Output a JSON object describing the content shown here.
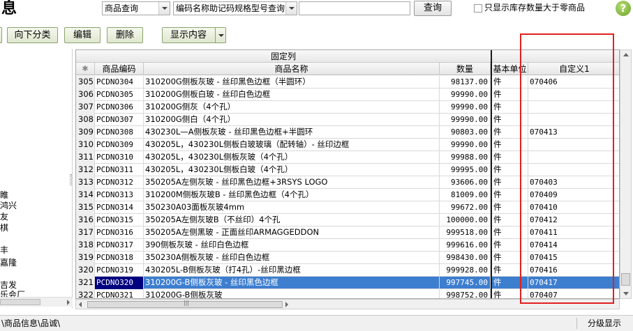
{
  "window": {
    "title": "息"
  },
  "search": {
    "mode_select": "商品查询",
    "field_select": "编码名称助记码规格型号查询",
    "input_value": "",
    "query_label": "查询",
    "stock_filter_label": "只显示库存数量大于零商品",
    "stock_filter_checked": false
  },
  "toolbar": {
    "down_category_label": "向下分类",
    "edit_label": "编辑",
    "delete_label": "删除",
    "display_label": "显示内容"
  },
  "tree": {
    "items": [
      "睢",
      "鸿兴",
      "友",
      "棋",
      "丰",
      "嘉隆",
      "吉发",
      "乐会厂"
    ]
  },
  "grid": {
    "fixed_columns_label": "固定列",
    "columns": {
      "row_marker": "✱",
      "code": "商品编码",
      "name": "商品名称",
      "quantity": "数量",
      "unit": "基本单位",
      "custom1": "自定义1"
    },
    "rows": [
      {
        "num": "305",
        "code": "PCDNO304",
        "name": "310200G侧板灰玻 - 丝印黑色边框（半圆环）",
        "qty": "98137.00",
        "unit": "件",
        "custom1": "070406",
        "selected": false
      },
      {
        "num": "306",
        "code": "PCDNO305",
        "name": "310200G侧板白玻 - 丝印白色边框",
        "qty": "99990.00",
        "unit": "件",
        "custom1": "",
        "selected": false
      },
      {
        "num": "307",
        "code": "PCDNO306",
        "name": "310200G侧灰（4个孔）",
        "qty": "99990.00",
        "unit": "件",
        "custom1": "",
        "selected": false
      },
      {
        "num": "308",
        "code": "PCDNO307",
        "name": "310200G侧白（4个孔）",
        "qty": "99990.00",
        "unit": "件",
        "custom1": "",
        "selected": false
      },
      {
        "num": "309",
        "code": "PCDNO308",
        "name": "430230L—A侧板灰玻 - 丝印黑色边框+半圆环",
        "qty": "90803.00",
        "unit": "件",
        "custom1": "070413",
        "selected": false
      },
      {
        "num": "310",
        "code": "PCDNO309",
        "name": "430205L，430230L侧板白玻玻璃（配转轴）- 丝印边框",
        "qty": "99990.00",
        "unit": "件",
        "custom1": "",
        "selected": false
      },
      {
        "num": "311",
        "code": "PCDNO310",
        "name": "430205L，430230L侧板灰玻（4个孔）",
        "qty": "99988.00",
        "unit": "件",
        "custom1": "",
        "selected": false
      },
      {
        "num": "312",
        "code": "PCDNO311",
        "name": "430205L，430230L侧板白玻（4个孔）",
        "qty": "99995.00",
        "unit": "件",
        "custom1": "",
        "selected": false
      },
      {
        "num": "313",
        "code": "PCDNO312",
        "name": "350205A左侧灰玻 - 丝印黑色边框+3RSYS LOGO",
        "qty": "93606.00",
        "unit": "件",
        "custom1": "070403",
        "selected": false
      },
      {
        "num": "314",
        "code": "PCDNO313",
        "name": "310200M侧板灰玻B - 丝印黑色边框（4个孔）",
        "qty": "81009.00",
        "unit": "件",
        "custom1": "070409",
        "selected": false
      },
      {
        "num": "315",
        "code": "PCDNO314",
        "name": "350230A03面板灰玻4mm",
        "qty": "99672.00",
        "unit": "件",
        "custom1": "070410",
        "selected": false
      },
      {
        "num": "316",
        "code": "PCDNO315",
        "name": "350205A左侧灰玻B（不丝印）4个孔",
        "qty": "100000.00",
        "unit": "件",
        "custom1": "070412",
        "selected": false
      },
      {
        "num": "317",
        "code": "PCDNO316",
        "name": "350205A左侧黑玻 - 正面丝印ARMAGGEDDON",
        "qty": "999518.00",
        "unit": "件",
        "custom1": "070411",
        "selected": false
      },
      {
        "num": "318",
        "code": "PCDNO317",
        "name": "390侧板灰玻 - 丝印白色边框",
        "qty": "999616.00",
        "unit": "件",
        "custom1": "070414",
        "selected": false
      },
      {
        "num": "319",
        "code": "PCDNO318",
        "name": "350230A侧板灰玻 - 丝印白色边框",
        "qty": "998430.00",
        "unit": "件",
        "custom1": "070415",
        "selected": false
      },
      {
        "num": "320",
        "code": "PCDNO319",
        "name": "430205L-B侧板灰玻（打4孔）-丝印黑边框",
        "qty": "999928.00",
        "unit": "件",
        "custom1": "070416",
        "selected": false
      },
      {
        "num": "321",
        "code": "PCDNO320",
        "name": "310200G-B侧板灰玻 - 丝印黑色边框",
        "qty": "997745.00",
        "unit": "件",
        "custom1": "070417",
        "selected": true
      },
      {
        "num": "322",
        "code": "PCDNO321",
        "name": "310200G-B侧板灰玻",
        "qty": "998752.00",
        "unit": "件",
        "custom1": "070407",
        "selected": false
      }
    ]
  },
  "status": {
    "path": "\\商品信息\\品诚\\",
    "right": "分级显示"
  },
  "colors": {
    "selected_row": "#3d7ecf",
    "highlight_box": "#e02020",
    "help_icon": "#6aa22a"
  }
}
